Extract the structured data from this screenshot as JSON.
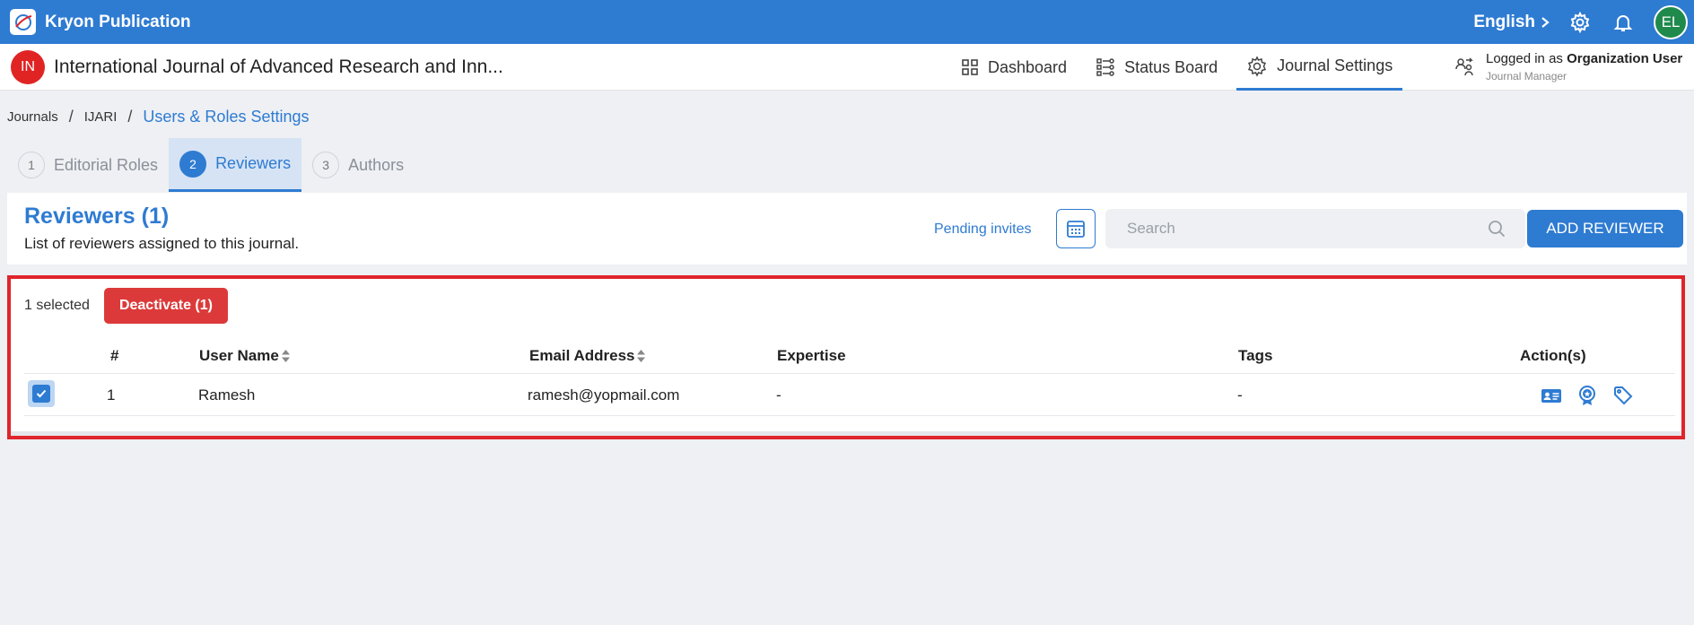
{
  "topbar": {
    "brand": "Kryon Publication",
    "language": "English",
    "avatar_initials": "EL"
  },
  "journal": {
    "badge": "IN",
    "title": "International Journal of Advanced Research and Inn..."
  },
  "nav": {
    "dashboard": "Dashboard",
    "status_board": "Status Board",
    "journal_settings": "Journal Settings"
  },
  "login": {
    "prefix": "Logged in as",
    "user": "Organization User",
    "role": "Journal Manager"
  },
  "breadcrumb": {
    "items": [
      "Journals",
      "IJARI",
      "Users & Roles Settings"
    ],
    "separator": "/"
  },
  "steps": [
    {
      "num": "1",
      "label": "Editorial Roles"
    },
    {
      "num": "2",
      "label": "Reviewers"
    },
    {
      "num": "3",
      "label": "Authors"
    }
  ],
  "panel": {
    "title": "Reviewers (1)",
    "subtitle": "List of reviewers assigned to this journal.",
    "pending_invites": "Pending invites",
    "search_placeholder": "Search",
    "add_button": "ADD REVIEWER"
  },
  "selection": {
    "text": "1 selected",
    "deactivate": "Deactivate (1)"
  },
  "table": {
    "headers": {
      "num": "#",
      "user_name": "User Name",
      "email": "Email Address",
      "expertise": "Expertise",
      "tags": "Tags",
      "actions": "Action(s)"
    },
    "rows": [
      {
        "num": "1",
        "user_name": "Ramesh",
        "email": "ramesh@yopmail.com",
        "expertise": "-",
        "tags": "-",
        "selected": true
      }
    ]
  },
  "colors": {
    "primary": "#2e7bd2",
    "danger": "#dc3a3a",
    "highlight_border": "#e0242c",
    "avatar_green": "#1f8a4c",
    "journal_badge_red": "#e02424"
  },
  "icons": {
    "brand": "kryon-logo-icon",
    "settings": "gear-icon",
    "notifications": "bell-icon",
    "dashboard": "grid-icon",
    "status_board": "board-icon",
    "journal_settings": "gear-icon",
    "login": "users-swap-icon",
    "calendar": "calendar-table-icon",
    "search": "search-icon",
    "row_actions": [
      "id-card-icon",
      "award-icon",
      "tag-icon"
    ]
  }
}
